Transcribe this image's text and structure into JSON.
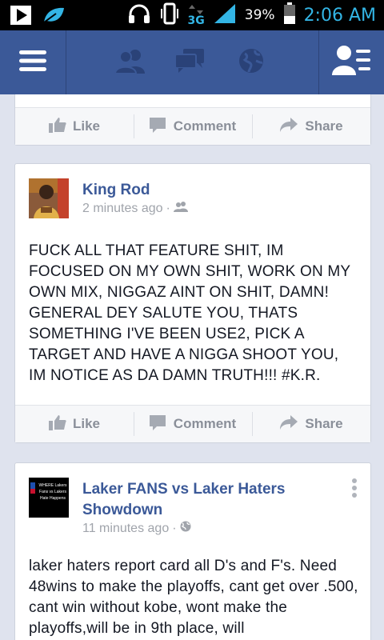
{
  "status_bar": {
    "network": "3G",
    "battery": "39%",
    "time": "2:06 AM",
    "accent_color": "#33b5e5"
  },
  "nav": {
    "icons": [
      "menu-icon",
      "friend-requests-icon",
      "messages-icon",
      "notifications-globe-icon",
      "friends-sidebar-icon"
    ]
  },
  "actions": {
    "like": "Like",
    "comment": "Comment",
    "share": "Share"
  },
  "posts": [
    {
      "author": "King Rod",
      "time": "2 minutes ago",
      "privacy_icon": "friends-icon",
      "text": "FUCK ALL THAT FEATURE SHIT, IM FOCUSED ON MY OWN SHIT, WORK ON MY OWN MIX, NIGGAZ AINT ON SHIT, DAMN! GENERAL DEY SALUTE YOU, THATS SOMETHING I'VE BEEN USE2, PICK A TARGET AND HAVE A NIGGA SHOOT YOU, IM NOTICE AS DA DAMN TRUTH!!! #K.R."
    },
    {
      "author": "Laker FANS vs Laker Haters Showdown",
      "time": "11 minutes ago",
      "privacy_icon": "public-globe-icon",
      "avatar_text": "WHERE Lakers Fans vs Lakers Hate Happens",
      "text": "laker haters report card all D's and F's. Need 48wins to make the playoffs, cant get over .500, cant win without kobe, wont make the playoffs,will be in 9th place, will"
    }
  ],
  "colors": {
    "brand": "#3b5998",
    "feed_bg": "#dfe3ee",
    "action_text": "#8a8f99"
  }
}
